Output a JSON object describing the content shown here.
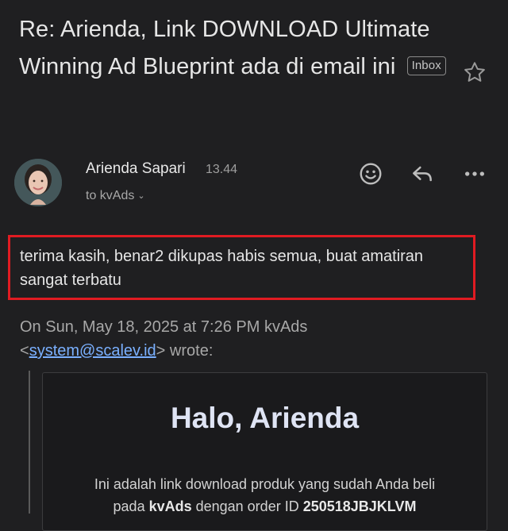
{
  "email": {
    "subject": "Re: Arienda, Link DOWNLOAD Ultimate Winning Ad Blueprint ada di email ini",
    "label_badge": "Inbox"
  },
  "sender": {
    "name": "Arienda Sapari",
    "time": "13.44",
    "recipient_line": "to kvAds"
  },
  "icons": {
    "star": "star-outline-icon",
    "emoji": "emoji-react-icon",
    "reply": "reply-icon",
    "more": "more-horizontal-icon"
  },
  "message": {
    "body": "terima kasih, benar2 dikupas habis semua, buat amatiran sangat terbatu",
    "highlight_color": "#e01b22"
  },
  "quoted": {
    "header_prefix": "On Sun, May 18, 2025 at 7:26 PM kvAds",
    "open_bracket": "<",
    "email_link": "system@scalev.id",
    "header_suffix": "> wrote:",
    "card_title": "Halo, Arienda",
    "text_1": "Ini adalah link download produk yang sudah Anda beli",
    "text_2a": "pada ",
    "brand": "kvAds",
    "text_2b": " dengan order ID ",
    "order_id": "250518JBJKLVM"
  },
  "colors": {
    "background": "#1f1f21",
    "link": "#7ab0ff",
    "card_title": "#dfe4f4"
  }
}
